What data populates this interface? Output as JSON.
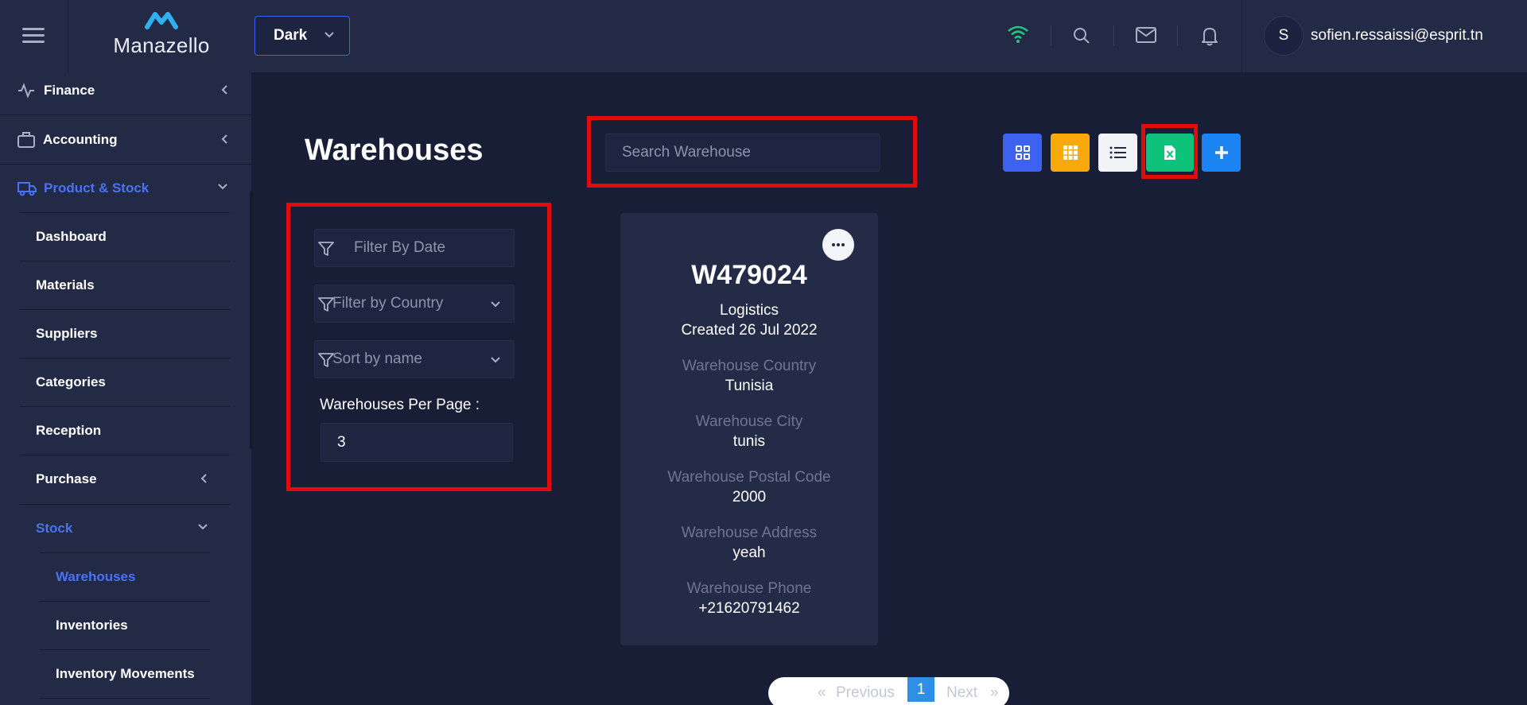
{
  "header": {
    "logo_text": "Manazello",
    "theme": "Dark",
    "user_initial": "S",
    "user_email": "sofien.ressaissi@esprit.tn"
  },
  "sidebar": {
    "items": [
      {
        "label": "Finance",
        "icon": "activity-icon"
      },
      {
        "label": "Accounting",
        "icon": "briefcase-icon"
      },
      {
        "label": "Product & Stock",
        "icon": "truck-icon"
      },
      {
        "label": "Dashboard"
      },
      {
        "label": "Materials"
      },
      {
        "label": "Suppliers"
      },
      {
        "label": "Categories"
      },
      {
        "label": "Reception"
      },
      {
        "label": "Purchase"
      },
      {
        "label": "Stock"
      },
      {
        "label": "Warehouses"
      },
      {
        "label": "Inventories"
      },
      {
        "label": "Inventory Movements"
      }
    ]
  },
  "main": {
    "title": "Warehouses",
    "search_placeholder": "Search Warehouse",
    "filters": {
      "date_placeholder": "Filter By Date",
      "country": "Filter by Country",
      "sort": "Sort by name",
      "per_page_label": "Warehouses Per Page :",
      "per_page_value": "3"
    }
  },
  "card": {
    "code": "W479024",
    "type": "Logistics",
    "created": "Created 26 Jul 2022",
    "country_label": "Warehouse Country",
    "country": "Tunisia",
    "city_label": "Warehouse City",
    "city": "tunis",
    "postal_label": "Warehouse Postal Code",
    "postal": "2000",
    "address_label": "Warehouse Address",
    "address": "yeah",
    "phone_label": "Warehouse Phone",
    "phone": "+21620791462"
  },
  "pagination": {
    "first": "«",
    "previous": "Previous",
    "current": "1",
    "next": "Next",
    "last": "»"
  },
  "colors": {
    "accent": "#3d62f0",
    "active_nav": "#4a72f5",
    "highlight_box": "#e00b0b",
    "grid_btn": "#3d62f0",
    "apps_btn": "#f9a90a",
    "list_btn": "#f2f3f7",
    "excel_btn": "#0ec27c",
    "add_btn": "#1b84f2"
  }
}
